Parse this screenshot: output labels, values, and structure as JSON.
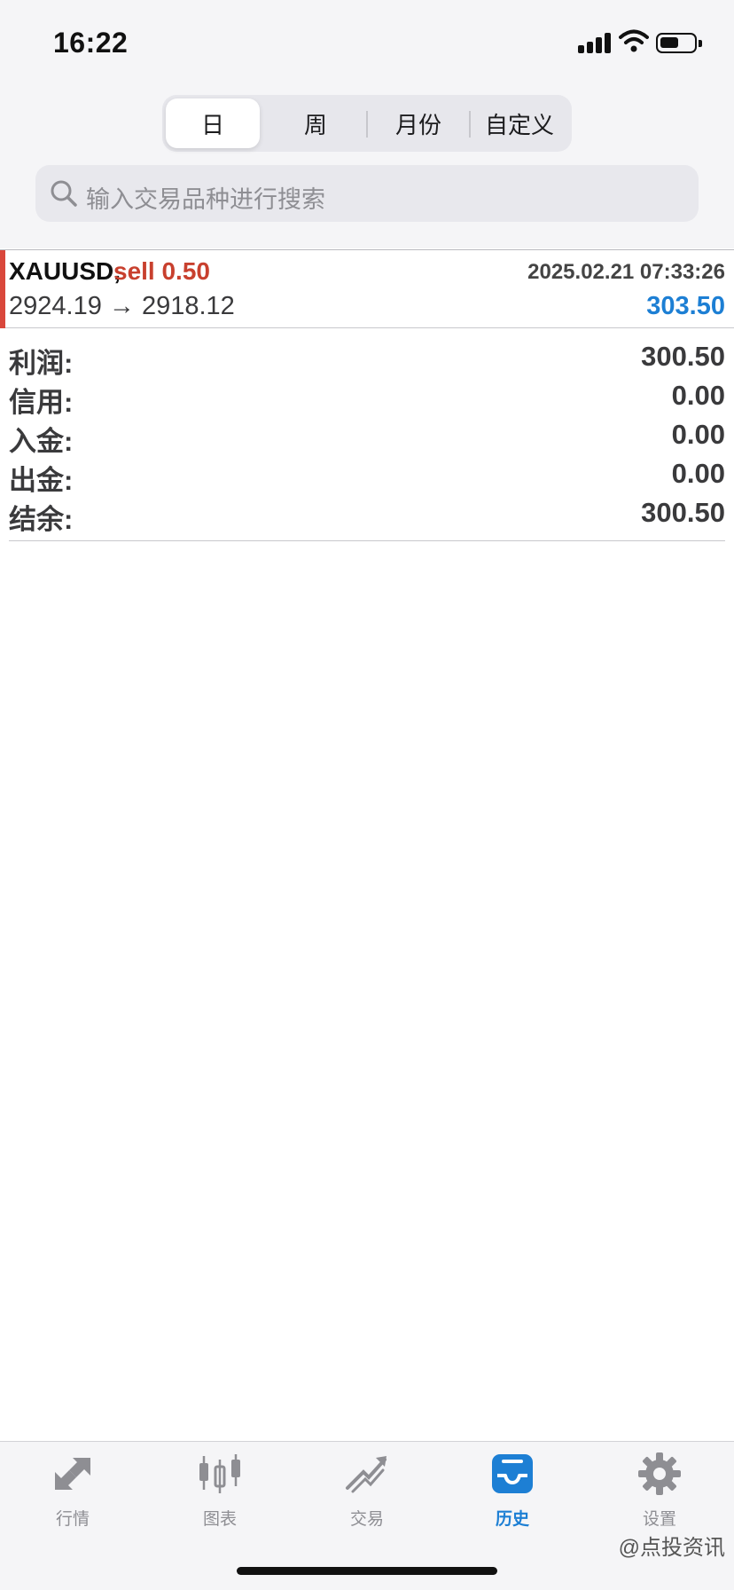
{
  "status_bar": {
    "time": "16:22"
  },
  "period_tabs": [
    {
      "label": "日",
      "active": true
    },
    {
      "label": "周",
      "active": false
    },
    {
      "label": "月份",
      "active": false
    },
    {
      "label": "自定义",
      "active": false
    }
  ],
  "search": {
    "placeholder": "输入交易品种进行搜索",
    "icon": "search-icon"
  },
  "trade": {
    "symbol": "XAUUSD,",
    "side": "sell 0.50",
    "time": "2025.02.21 07:33:26",
    "prices": "2924.19 → 2918.12",
    "profit": "303.50"
  },
  "summary": [
    {
      "label": "利润:",
      "value": "300.50"
    },
    {
      "label": "信用:",
      "value": "0.00"
    },
    {
      "label": "入金:",
      "value": "0.00"
    },
    {
      "label": "出金:",
      "value": "0.00"
    },
    {
      "label": "结余:",
      "value": "300.50"
    }
  ],
  "tabbar": [
    {
      "label": "行情",
      "icon": "quotes-arrows-icon",
      "active": false
    },
    {
      "label": "图表",
      "icon": "candlestick-chart-icon",
      "active": false
    },
    {
      "label": "交易",
      "icon": "trade-trend-icon",
      "active": false
    },
    {
      "label": "历史",
      "icon": "history-inbox-icon",
      "active": true
    },
    {
      "label": "设置",
      "icon": "gear-icon",
      "active": false
    }
  ],
  "watermark": "@点投资讯",
  "colors": {
    "accent_blue": "#1d7fd4",
    "sell_red": "#c8402e",
    "marker_red": "#d9473b"
  }
}
